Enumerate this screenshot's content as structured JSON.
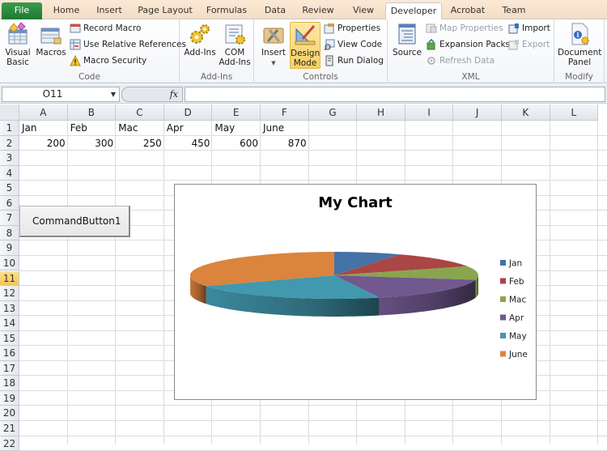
{
  "tabs": [
    {
      "label": "File"
    },
    {
      "label": "Home"
    },
    {
      "label": "Insert"
    },
    {
      "label": "Page Layout"
    },
    {
      "label": "Formulas"
    },
    {
      "label": "Data"
    },
    {
      "label": "Review"
    },
    {
      "label": "View"
    },
    {
      "label": "Developer"
    },
    {
      "label": "Acrobat"
    },
    {
      "label": "Team"
    }
  ],
  "active_tab": "Developer",
  "ribbon": {
    "code": {
      "label": "Code",
      "visual_basic": "Visual Basic",
      "visual_basic_l1": "Visual",
      "visual_basic_l2": "Basic",
      "macros": "Macros",
      "record_macro": "Record Macro",
      "use_relative": "Use Relative References",
      "macro_security": "Macro Security"
    },
    "addins": {
      "label": "Add-Ins",
      "addins": "Add-Ins",
      "com_l1": "COM",
      "com_l2": "Add-Ins"
    },
    "controls": {
      "label": "Controls",
      "insert": "Insert",
      "design_l1": "Design",
      "design_l2": "Mode",
      "properties": "Properties",
      "view_code": "View Code",
      "run_dialog": "Run Dialog"
    },
    "xml": {
      "label": "XML",
      "source": "Source",
      "map_properties": "Map Properties",
      "expansion_packs": "Expansion Packs",
      "refresh_data": "Refresh Data",
      "import": "Import",
      "export": "Export"
    },
    "modify": {
      "label": "Modify",
      "doc_l1": "Document",
      "doc_l2": "Panel"
    }
  },
  "formula_bar": {
    "name_box": "O11",
    "fx_label": "fx",
    "formula": ""
  },
  "sheet": {
    "columns": [
      "A",
      "B",
      "C",
      "D",
      "E",
      "F",
      "G",
      "H",
      "I",
      "J",
      "K",
      "L"
    ],
    "rows": [
      "1",
      "2",
      "3",
      "4",
      "5",
      "6",
      "7",
      "8",
      "9",
      "10",
      "11",
      "12",
      "13",
      "14",
      "15",
      "16",
      "17",
      "18",
      "19",
      "20",
      "21",
      "22"
    ],
    "selected_row": "11",
    "row1": [
      "Jan",
      "Feb",
      "Mac",
      "Apr",
      "May",
      "June"
    ],
    "row2": [
      "200",
      "300",
      "250",
      "450",
      "600",
      "870"
    ]
  },
  "command_button": {
    "label": "CommandButton1"
  },
  "chart_data": {
    "type": "pie",
    "title": "My Chart",
    "categories": [
      "Jan",
      "Feb",
      "Mac",
      "Apr",
      "May",
      "June"
    ],
    "values": [
      200,
      300,
      250,
      450,
      600,
      870
    ],
    "colors": [
      "#4572a7",
      "#aa4643",
      "#89a54e",
      "#71588f",
      "#4198af",
      "#db843d"
    ],
    "legend_position": "right",
    "style": "3d"
  }
}
